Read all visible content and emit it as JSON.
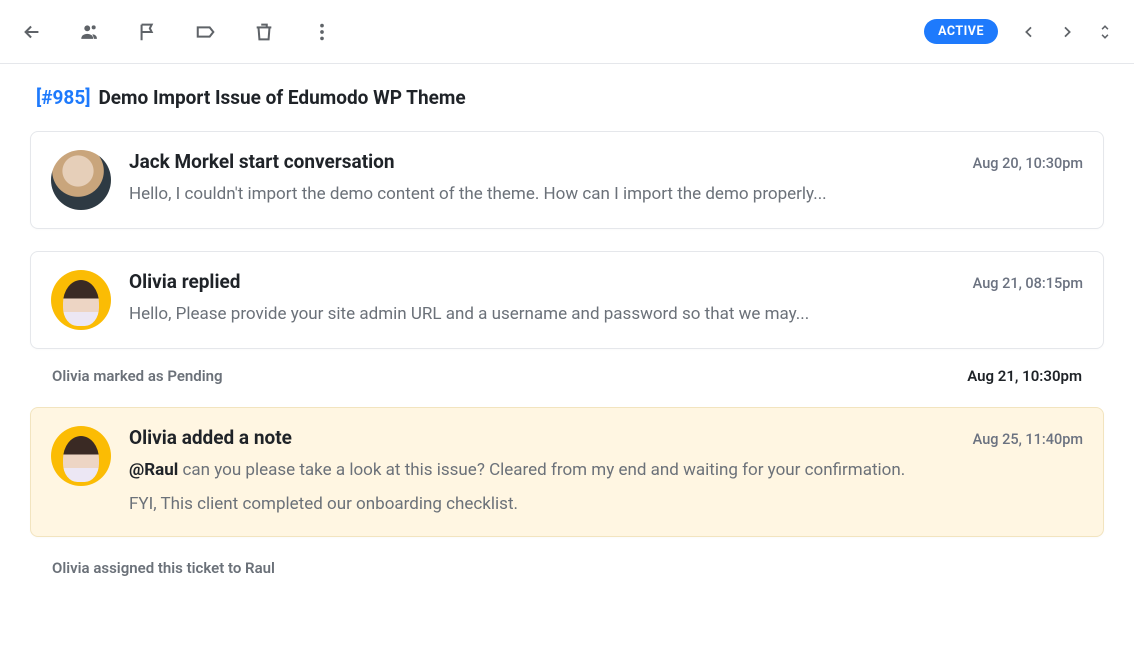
{
  "toolbar": {
    "status": "ACTIVE"
  },
  "ticket": {
    "id": "[#985]",
    "title": "Demo Import Issue of Edumodo WP Theme"
  },
  "messages": [
    {
      "author": "Jack Morkel start conversation",
      "time": "Aug 20, 10:30pm",
      "body": "Hello, I couldn't import the demo content of the theme. How can I import the demo properly..."
    },
    {
      "author": "Olivia replied",
      "time": "Aug 21, 08:15pm",
      "body": "Hello, Please provide your site admin URL and a username and password so that we may..."
    }
  ],
  "pending": {
    "text": "Olivia marked as Pending",
    "time": "Aug 21, 10:30pm"
  },
  "note": {
    "author": "Olivia added a note",
    "time": "Aug 25, 11:40pm",
    "mention": "@Raul",
    "line1_rest": " can you please take a look at this issue? Cleared from my end and waiting for your confirmation.",
    "line2": "FYI, This client completed our onboarding checklist."
  },
  "assignment": "Olivia assigned this ticket to Raul"
}
